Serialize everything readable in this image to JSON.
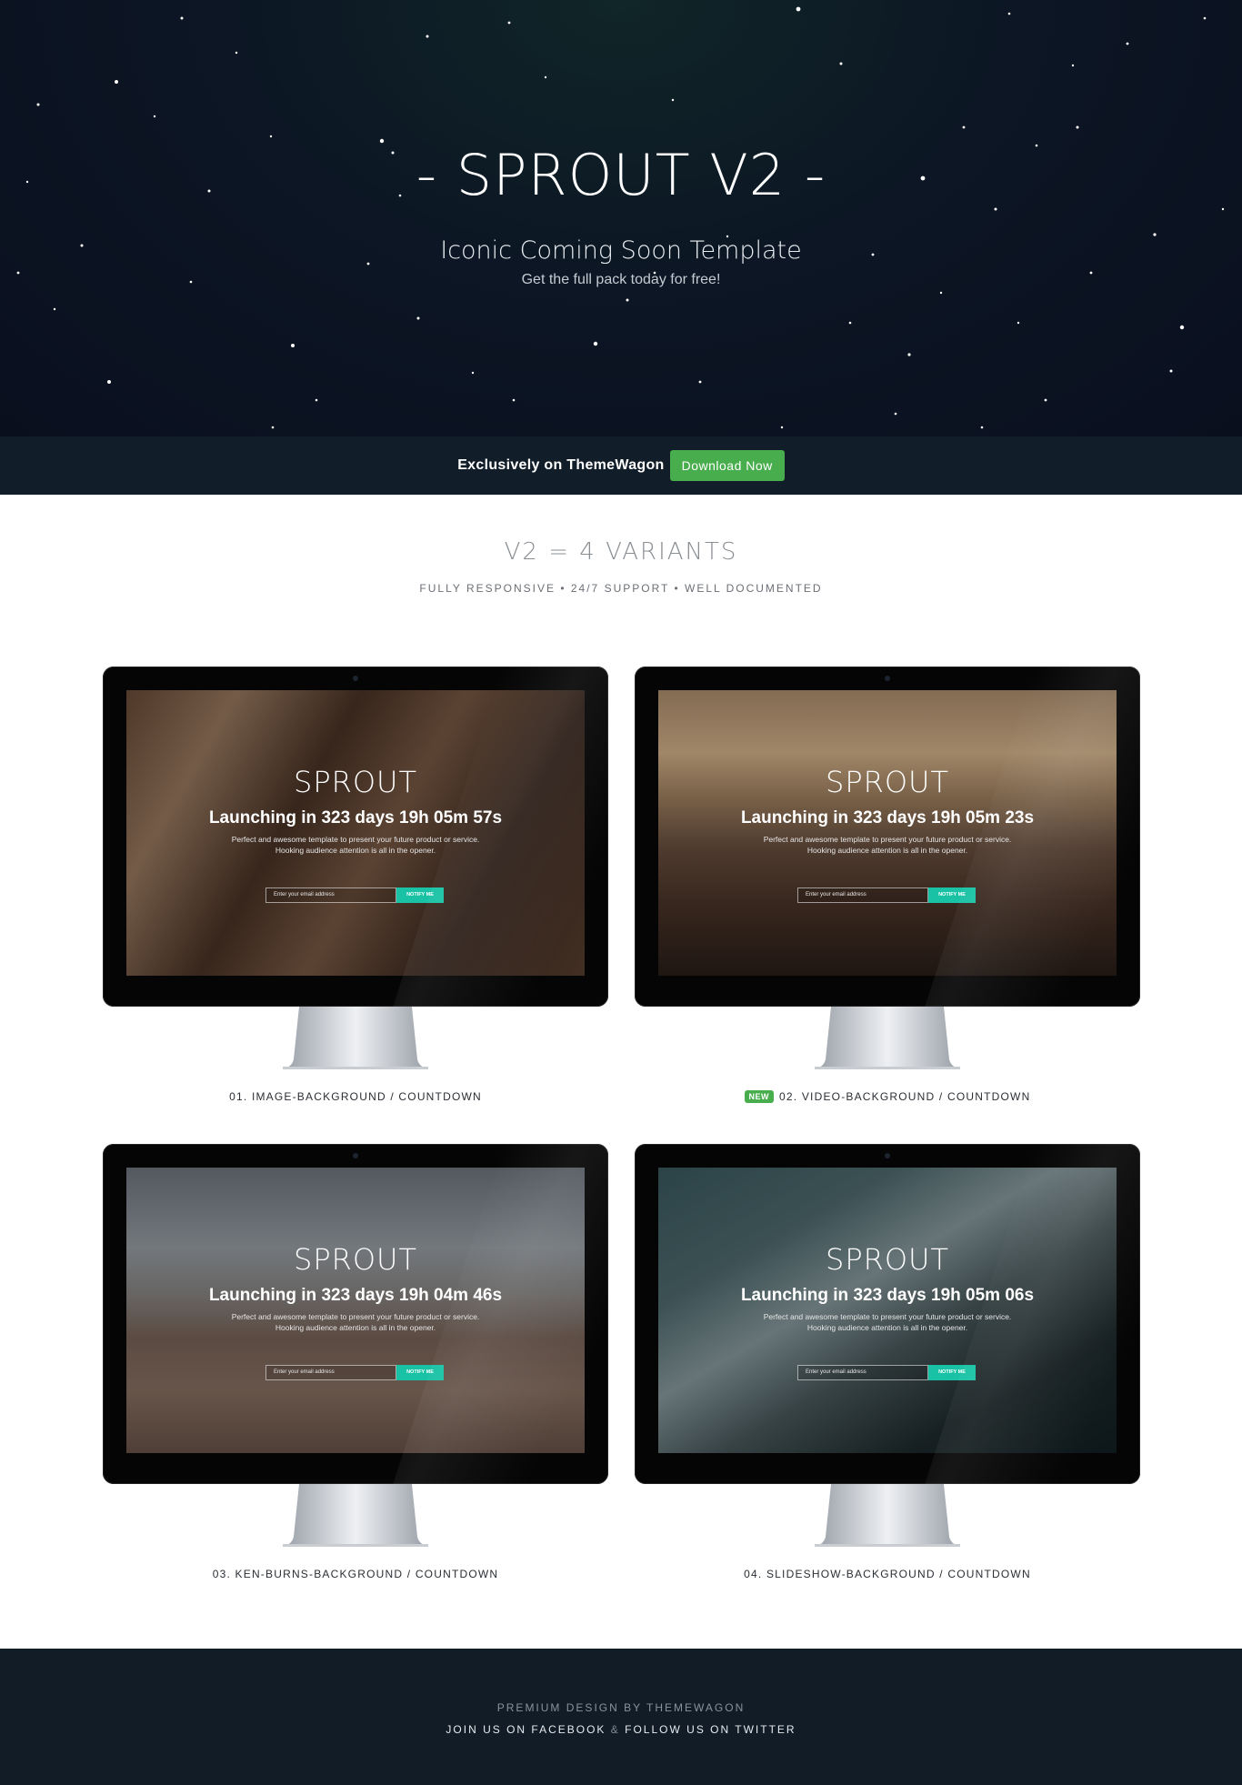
{
  "hero": {
    "title": "- SPROUT V2 -",
    "subtitle": "Iconic Coming Soon Template",
    "tagline": "Get the full pack today for free!"
  },
  "strip": {
    "text": "Exclusively on ThemeWagon",
    "button_label": "Download Now",
    "button_color": "#48ad4d"
  },
  "intro": {
    "title": "V2 = 4 VARIANTS",
    "subtitle": "FULLY RESPONSIVE • 24/7 SUPPORT • WELL DOCUMENTED"
  },
  "variants": [
    {
      "brand": "SPROUT",
      "launch": "Launching in 323 days 19h 05m 57s",
      "desc": "Perfect and awesome template to present your future product or service. Hooking audience attention is all in the opener.",
      "input_placeholder": "Enter your email address",
      "button_label": "NOTIFY ME",
      "caption": "01. IMAGE-BACKGROUND / COUNTDOWN",
      "badge": ""
    },
    {
      "brand": "SPROUT",
      "launch": "Launching in 323 days 19h 05m 23s",
      "desc": "Perfect and awesome template to present your future product or service. Hooking audience attention is all in the opener.",
      "input_placeholder": "Enter your email address",
      "button_label": "NOTIFY ME",
      "caption": "02. VIDEO-BACKGROUND / COUNTDOWN",
      "badge": "NEW"
    },
    {
      "brand": "SPROUT",
      "launch": "Launching in 323 days 19h 04m 46s",
      "desc": "Perfect and awesome template to present your future product or service. Hooking audience attention is all in the opener.",
      "input_placeholder": "Enter your email address",
      "button_label": "NOTIFY ME",
      "caption": "03. KEN-BURNS-BACKGROUND / COUNTDOWN",
      "badge": ""
    },
    {
      "brand": "SPROUT",
      "launch": "Launching in 323 days 19h 05m 06s",
      "desc": "Perfect and awesome template to present your future product or service. Hooking audience attention is all in the opener.",
      "input_placeholder": "Enter your email address",
      "button_label": "NOTIFY ME",
      "caption": "04. SLIDESHOW-BACKGROUND / COUNTDOWN",
      "badge": ""
    }
  ],
  "footer": {
    "credit": "PREMIUM DESIGN BY THEMEWAGON",
    "facebook": "JOIN US ON FACEBOOK",
    "amp": "&",
    "twitter": "FOLLOW US ON TWITTER"
  },
  "colors": {
    "hero_bg": "#0a0f1e",
    "strip_bg": "#111d28",
    "footer_bg": "#111c27",
    "notify_button": "#19c2a5"
  }
}
